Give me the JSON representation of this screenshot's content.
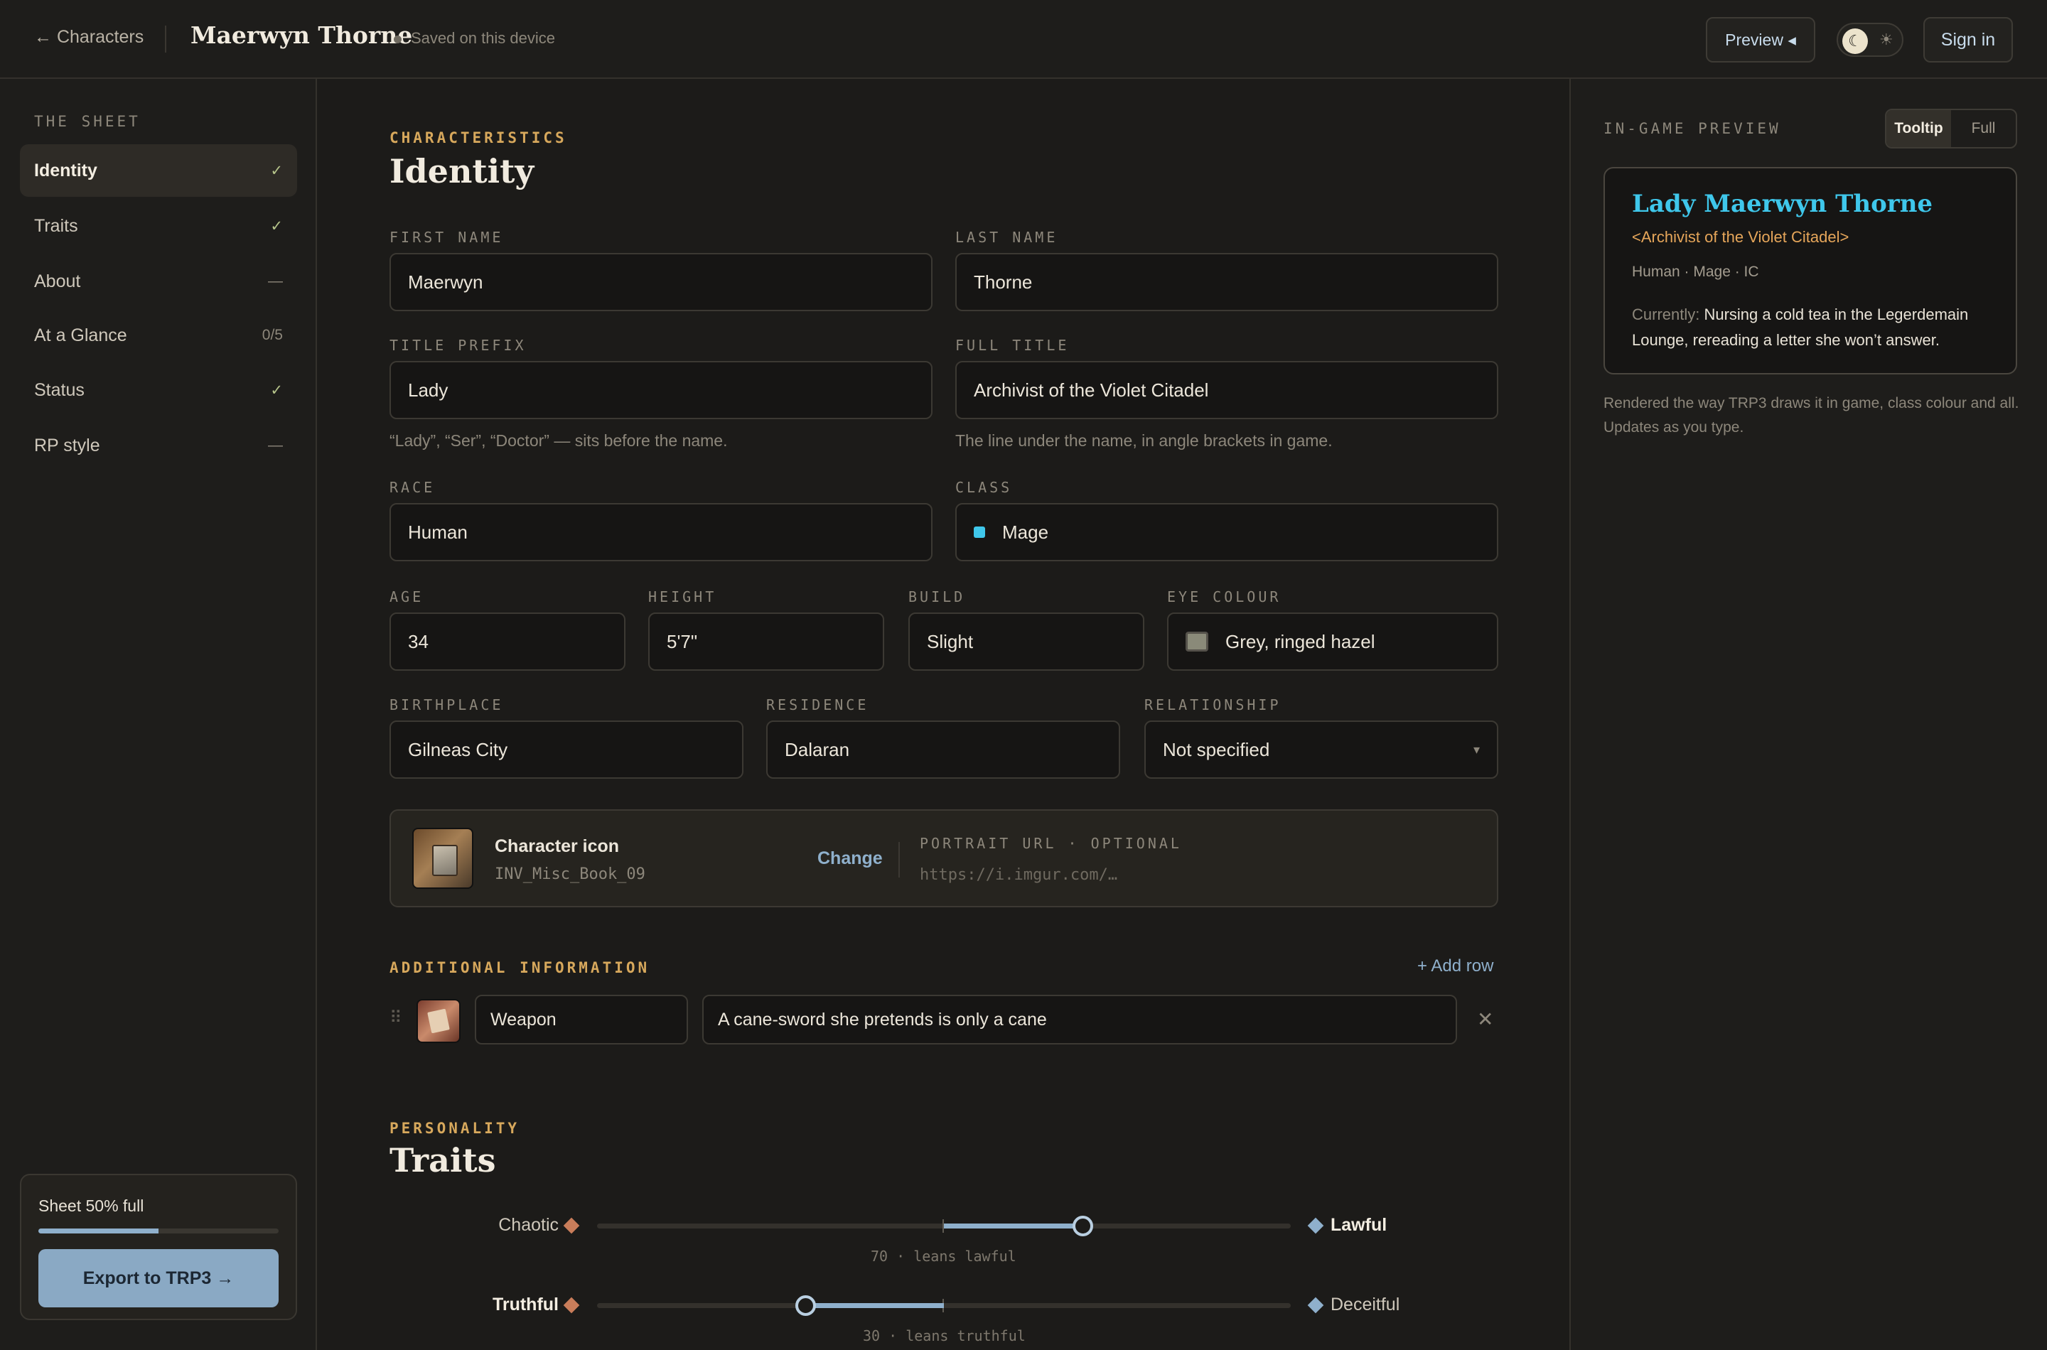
{
  "topbar": {
    "back_label": "← Characters",
    "character_name": "Maerwyn Thorne",
    "saved_status": "Saved on this device",
    "preview_button": "Preview ◂",
    "theme_moon_icon": "moon-icon",
    "theme_sun_icon": "sun-icon",
    "sign_in": "Sign in"
  },
  "sidebar": {
    "heading": "THE SHEET",
    "items": [
      {
        "label": "Identity",
        "mark": "✓"
      },
      {
        "label": "Traits",
        "mark": "✓"
      },
      {
        "label": "About",
        "mark": "—"
      },
      {
        "label": "At a Glance",
        "mark": "0/5"
      },
      {
        "label": "Status",
        "mark": "✓"
      },
      {
        "label": "RP style",
        "mark": "—"
      }
    ],
    "progress_label": "Sheet 50% full",
    "progress_fraction": 0.5,
    "export_button": "Export to TRP3 →"
  },
  "identity": {
    "eyebrow": "CHARACTERISTICS",
    "heading": "Identity",
    "first_name": {
      "label": "FIRST NAME",
      "value": "Maerwyn"
    },
    "last_name": {
      "label": "LAST NAME",
      "value": "Thorne"
    },
    "title_prefix": {
      "label": "TITLE PREFIX",
      "value": "Lady",
      "help": "“Lady”, “Ser”, “Doctor” — sits before the name."
    },
    "full_title": {
      "label": "FULL TITLE",
      "value": "Archivist of the Violet Citadel",
      "help": "The line under the name, in angle brackets in game."
    },
    "race": {
      "label": "RACE",
      "value": "Human"
    },
    "class": {
      "label": "CLASS",
      "value": "Mage",
      "color": "#3fc7eb"
    },
    "age": {
      "label": "AGE",
      "value": "34"
    },
    "height": {
      "label": "HEIGHT",
      "value": "5'7\""
    },
    "build": {
      "label": "BUILD",
      "value": "Slight"
    },
    "eye_colour": {
      "label": "EYE COLOUR",
      "value": "Grey, ringed hazel"
    },
    "birthplace": {
      "label": "BIRTHPLACE",
      "value": "Gilneas City"
    },
    "residence": {
      "label": "RESIDENCE",
      "value": "Dalaran"
    },
    "relationship": {
      "label": "RELATIONSHIP",
      "value": "Not specified",
      "caret": "▾"
    },
    "icon_card": {
      "title": "Character icon",
      "icon_code": "INV_Misc_Book_09",
      "change": "Change",
      "portrait_label": "PORTRAIT URL · OPTIONAL",
      "portrait_placeholder": "https://i.imgur.com/…"
    }
  },
  "additional": {
    "eyebrow": "ADDITIONAL INFORMATION",
    "add_row": "+ Add row",
    "drag_icon": "drag-handle-icon",
    "rows": [
      {
        "name": "Weapon",
        "value": "A cane-sword she pretends is only a cane",
        "remove": "✕"
      }
    ]
  },
  "traits": {
    "eyebrow": "PERSONALITY",
    "heading": "Traits",
    "sliders": [
      {
        "left": "Chaotic",
        "right": "Lawful",
        "value": 70,
        "caption": "70 · leans lawful",
        "strong": "right"
      },
      {
        "left": "Truthful",
        "right": "Deceitful",
        "value": 30,
        "caption": "30 · leans truthful",
        "strong": "left"
      }
    ]
  },
  "preview": {
    "heading": "IN-GAME PREVIEW",
    "tabs": [
      "Tooltip",
      "Full"
    ],
    "active_tab": "Tooltip",
    "name": "Lady Maerwyn Thorne",
    "title": "<Archivist of the Violet Citadel>",
    "meta": "Human · Mage · IC",
    "currently_label": "Currently:",
    "currently_text": " Nursing a cold tea in the Legerdemain Lounge, rereading a letter she won’t answer.",
    "note": "Rendered the way TRP3 draws it in game, class colour and all. Updates as you type."
  }
}
